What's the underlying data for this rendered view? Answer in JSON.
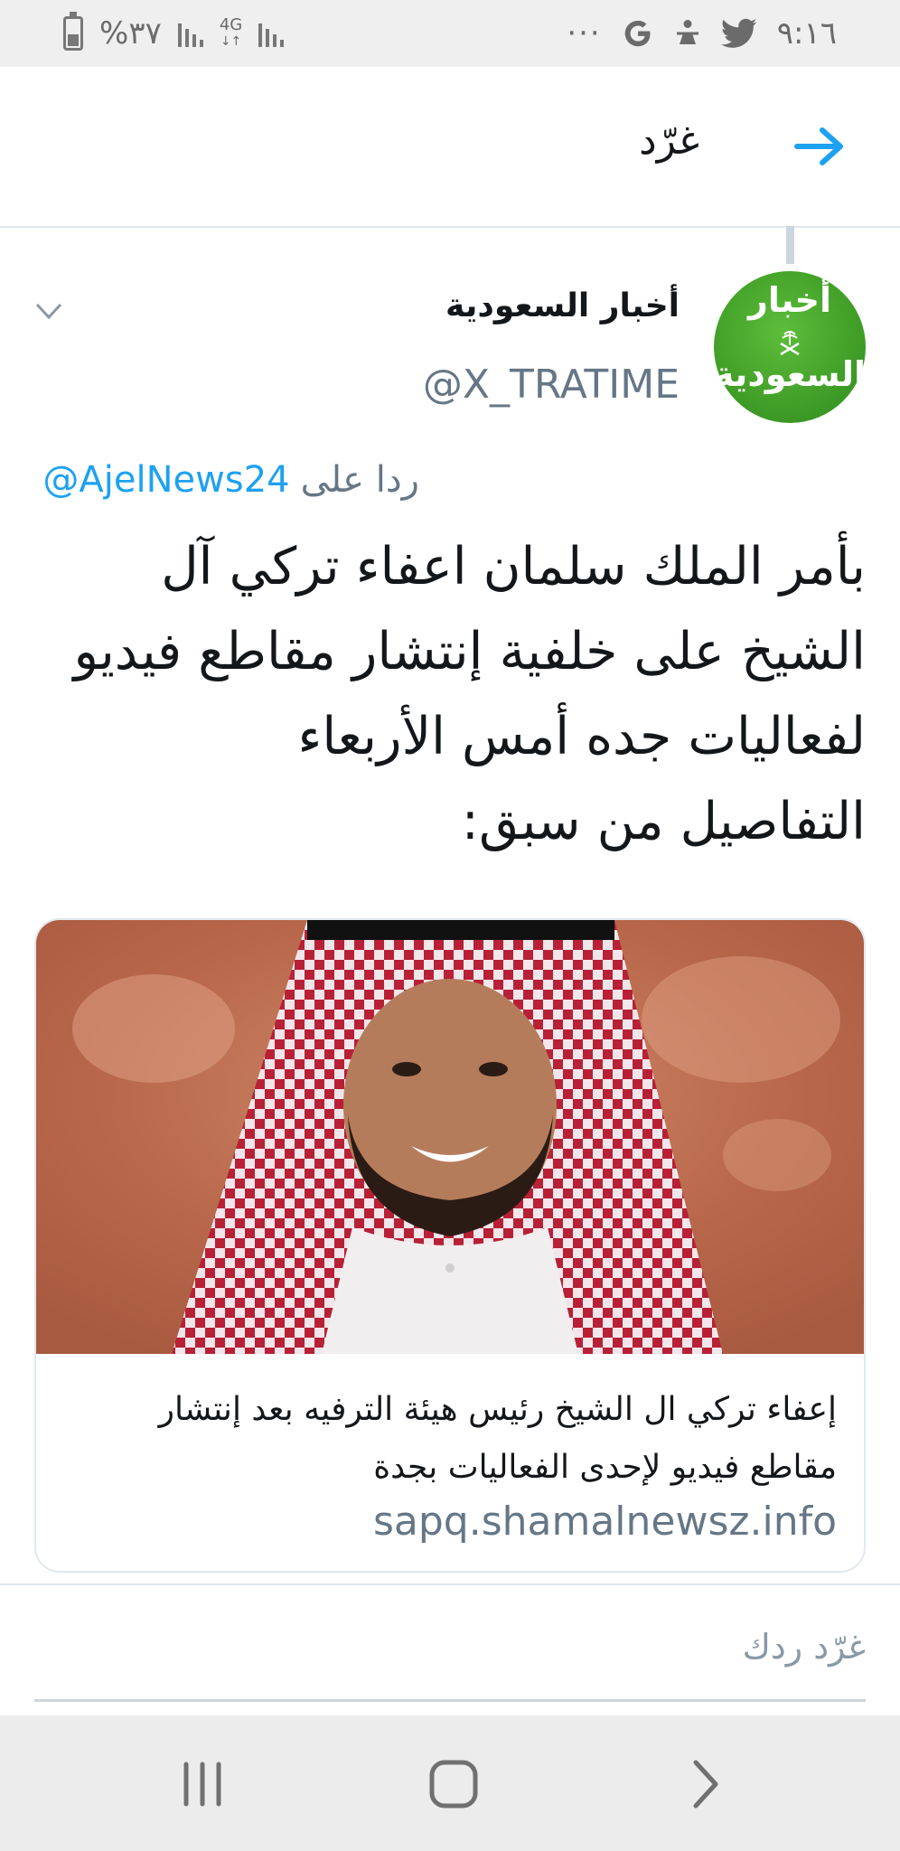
{
  "status_bar": {
    "battery_text": "%٣٧",
    "network_label": "4G",
    "more_dots": "···",
    "time": "٩:١٦",
    "icons": [
      "battery-icon",
      "signal-icon",
      "network-4g-icon",
      "signal-icon",
      "google-icon",
      "notification-icon",
      "twitter-icon"
    ]
  },
  "header": {
    "title": "غرّد",
    "back_icon": "arrow-right-icon",
    "accent_color": "#1da1f2"
  },
  "tweet": {
    "avatar": {
      "line1": "أخبار",
      "line2": "السعودية"
    },
    "display_name": "أخبار السعودية",
    "handle": "@X_TRATIME",
    "reply_prefix": "ردا على",
    "reply_to": "@AjelNews24",
    "text_lines": [
      "بأمر الملك سلمان اعفاء تركي آل",
      "الشيخ على خلفية إنتشار مقاطع فيديو",
      "لفعاليات جده أمس الأربعاء",
      "التفاصيل من سبق:"
    ],
    "card": {
      "title_lines": [
        "إعفاء تركي ال الشيخ رئيس هيئة الترفيه بعد إنتشار",
        "مقاطع فيديو لإحدى الفعاليات بجدة"
      ],
      "domain": "sapq.shamalnewsz.info"
    }
  },
  "compose": {
    "placeholder": "غرّد ردك"
  },
  "nav_bar": {
    "icons": [
      "recent-apps-icon",
      "home-icon",
      "back-icon"
    ]
  }
}
